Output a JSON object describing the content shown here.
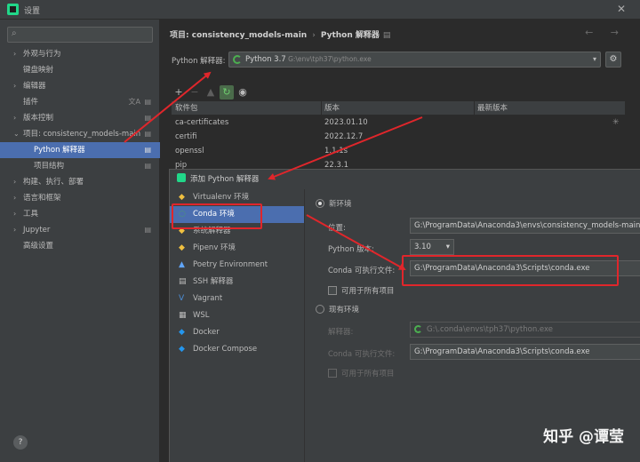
{
  "window": {
    "title": "设置"
  },
  "sidebar": {
    "search_placeholder": "",
    "items": [
      {
        "label": "外观与行为",
        "caret": "›"
      },
      {
        "label": "键盘映射",
        "caret": ""
      },
      {
        "label": "编辑器",
        "caret": "›"
      },
      {
        "label": "插件",
        "caret": ""
      },
      {
        "label": "版本控制",
        "caret": "›"
      },
      {
        "label": "项目: consistency_models-main",
        "caret": "⌄"
      },
      {
        "label": "Python 解释器",
        "caret": ""
      },
      {
        "label": "项目结构",
        "caret": ""
      },
      {
        "label": "构建、执行、部署",
        "caret": "›"
      },
      {
        "label": "语言和框架",
        "caret": "›"
      },
      {
        "label": "工具",
        "caret": "›"
      },
      {
        "label": "Jupyter",
        "caret": "›"
      },
      {
        "label": "高级设置",
        "caret": ""
      }
    ],
    "help_label": "?"
  },
  "header": {
    "crumb_project": "项目: consistency_models-main",
    "crumb_sep": "›",
    "crumb_page": "Python 解释器",
    "crumb_icon": "▤",
    "nav_arrows": "← →"
  },
  "interpreter": {
    "label": "Python 解释器:",
    "name": "Python 3.7",
    "path": " G:\\env\\tph37\\python.exe",
    "dropdown": "▾",
    "gear": "⚙"
  },
  "toolbar": {
    "add": "+",
    "remove": "−",
    "up": "▲",
    "refresh": "↻",
    "eye": "◉"
  },
  "packages": {
    "columns": [
      "软件包",
      "版本",
      "最新版本"
    ],
    "rows": [
      {
        "name": "ca-certificates",
        "version": "2023.01.10",
        "latest": ""
      },
      {
        "name": "certifi",
        "version": "2022.12.7",
        "latest": ""
      },
      {
        "name": "openssl",
        "version": "1.1.1s",
        "latest": ""
      },
      {
        "name": "pip",
        "version": "22.3.1",
        "latest": ""
      }
    ]
  },
  "dialog": {
    "title": "添加 Python 解释器",
    "env_types": [
      {
        "label": "Virtualenv 环境",
        "icon": "◆",
        "color": "#f0c040"
      },
      {
        "label": "Conda 环境",
        "icon": "◌",
        "color": "#4caf50"
      },
      {
        "label": "系统解释器",
        "icon": "◆",
        "color": "#f0c040"
      },
      {
        "label": "Pipenv 环境",
        "icon": "◆",
        "color": "#f0c040"
      },
      {
        "label": "Poetry Environment",
        "icon": "▲",
        "color": "#60a5fa"
      },
      {
        "label": "SSH 解释器",
        "icon": "▤",
        "color": "#bbbbbb"
      },
      {
        "label": "Vagrant",
        "icon": "V",
        "color": "#4c8ed8"
      },
      {
        "label": "WSL",
        "icon": "▦",
        "color": "#bbbbbb"
      },
      {
        "label": "Docker",
        "icon": "◆",
        "color": "#2496ed"
      },
      {
        "label": "Docker Compose",
        "icon": "◆",
        "color": "#2496ed"
      }
    ],
    "new_env_label": "新环境",
    "location_label": "位置:",
    "location_value": "G:\\ProgramData\\Anaconda3\\envs\\consistency_models-main",
    "python_version_label": "Python 版本:",
    "python_version_value": "3.10",
    "python_version_arrow": "▾",
    "conda_exe_label": "Conda 可执行文件:",
    "conda_exe_value": "G:\\ProgramData\\Anaconda3\\Scripts\\conda.exe",
    "all_projects_label": "可用于所有项目",
    "existing_env_label": "现有环境",
    "interpreter_label": "解释器:",
    "interpreter_value": "G:\\.conda\\envs\\tph37\\python.exe",
    "existing_conda_label": "Conda 可执行文件:",
    "existing_conda_value": "G:\\ProgramData\\Anaconda3\\Scripts\\conda.exe",
    "existing_all_projects_label": "可用于所有项目"
  },
  "watermark": "知乎 @谭莹",
  "colors": {
    "accent": "#4b6eaf",
    "annotation_red": "#e0262b",
    "bg_dark": "#2b2b2b",
    "panel": "#3c3f41"
  }
}
